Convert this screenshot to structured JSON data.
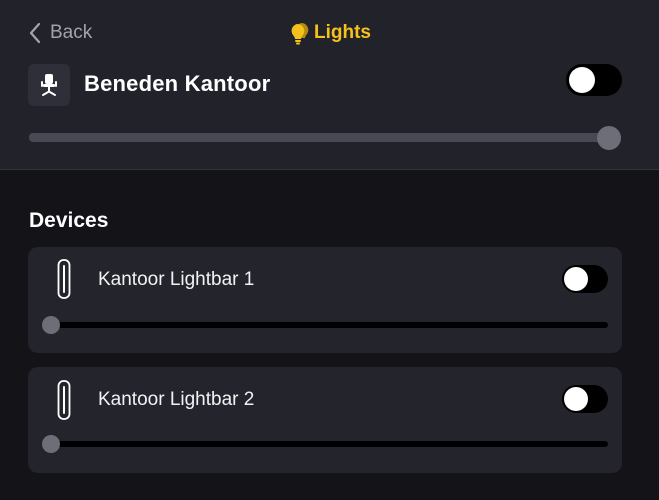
{
  "nav": {
    "back_label": "Back",
    "title": "Lights",
    "title_icon": "lightbulb-icon"
  },
  "colors": {
    "accent": "#f5c21b",
    "background": "#131318",
    "panel": "#22222b",
    "card": "#24242d"
  },
  "room": {
    "icon": "office-chair-icon",
    "name": "Beneden Kantoor",
    "on": false,
    "brightness_fraction": 1.0
  },
  "devices_section": {
    "title": "Devices"
  },
  "devices": [
    {
      "icon": "lightbar-icon",
      "name": "Kantoor Lightbar 1",
      "on": false,
      "brightness_fraction": 0.0
    },
    {
      "icon": "lightbar-icon",
      "name": "Kantoor Lightbar 2",
      "on": false,
      "brightness_fraction": 0.0
    }
  ]
}
